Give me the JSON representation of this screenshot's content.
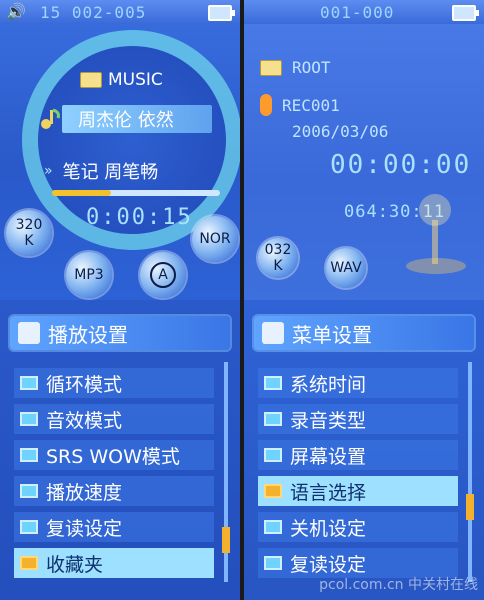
{
  "colors": {
    "accent": "#9de0ff",
    "highlight": "#f4b12c",
    "digits": "#a9e1ff"
  },
  "player": {
    "counter": "15 002-005",
    "music_label": "MUSIC",
    "song": "周杰伦 依然",
    "artist": "笔记 周笔畅",
    "progress": 0.35,
    "time": "0:00:15",
    "bitrate": {
      "line1": "320",
      "line2": "K"
    },
    "mode": "NOR",
    "format": "MP3",
    "repeat": "A",
    "icons": {
      "speaker": "speaker-icon",
      "folder": "folder-icon",
      "note": "music-note-icon",
      "artist_arrow": "arrow-icon",
      "battery": "battery-icon"
    }
  },
  "recorder": {
    "counter": "001-000",
    "root": "ROOT",
    "file": "REC001",
    "date": "2006/03/06",
    "time": "00:00:00",
    "remaining": "064:30:11",
    "bitrate": {
      "line1": "032",
      "line2": "K"
    },
    "format": "WAV"
  },
  "menu_left": {
    "title": "播放设置",
    "items": [
      {
        "label": "循环模式"
      },
      {
        "label": "音效模式"
      },
      {
        "label": "SRS WOW模式"
      },
      {
        "label": "播放速度"
      },
      {
        "label": "复读设定"
      },
      {
        "label": "收藏夹",
        "selected": true
      }
    ],
    "scroll_position": 0.85
  },
  "menu_right": {
    "title": "菜单设置",
    "items": [
      {
        "label": "系统时间"
      },
      {
        "label": "录音类型"
      },
      {
        "label": "屏幕设置"
      },
      {
        "label": "语言选择",
        "selected": true
      },
      {
        "label": "关机设定"
      },
      {
        "label": "复读设定"
      }
    ],
    "scroll_position": 0.68,
    "watermark": "pcol.com.cn 中关村在线"
  }
}
